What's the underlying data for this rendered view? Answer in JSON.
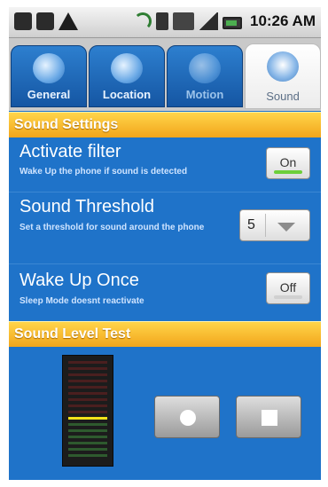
{
  "status_bar": {
    "time": "10:26 AM",
    "left_icons": [
      "voicemail-icon",
      "usb-icon",
      "warning-icon"
    ],
    "right_icons": [
      "gps-icon",
      "vibrate-icon",
      "mute-icon",
      "signal-icon",
      "battery-icon"
    ]
  },
  "tabs": [
    {
      "label": "General",
      "icon": "general-tab-icon",
      "active": false
    },
    {
      "label": "Location",
      "icon": "location-tab-icon",
      "active": false
    },
    {
      "label": "Motion",
      "icon": "motion-tab-icon",
      "active": false
    },
    {
      "label": "Sound",
      "icon": "sound-tab-icon",
      "active": true
    }
  ],
  "sound_settings": {
    "header": "Sound Settings",
    "activate_filter": {
      "title": "Activate filter",
      "subtitle": "Wake Up the phone if sound is detected",
      "toggle_label": "On"
    },
    "sound_threshold": {
      "title": "Sound Threshold",
      "subtitle": "Set a threshold for sound around the phone",
      "value": "5"
    },
    "wake_up_once": {
      "title": "Wake Up Once",
      "subtitle": "Sleep Mode doesnt reactivate",
      "toggle_label": "Off"
    }
  },
  "sound_level_test": {
    "header": "Sound Level Test",
    "meter_level_fraction": 0.43
  },
  "colors": {
    "background": "#1f73c9",
    "section_header": "#f2a51b",
    "toggle_on": "#6ccf3a",
    "meter_level_line": "#f2e21a"
  }
}
